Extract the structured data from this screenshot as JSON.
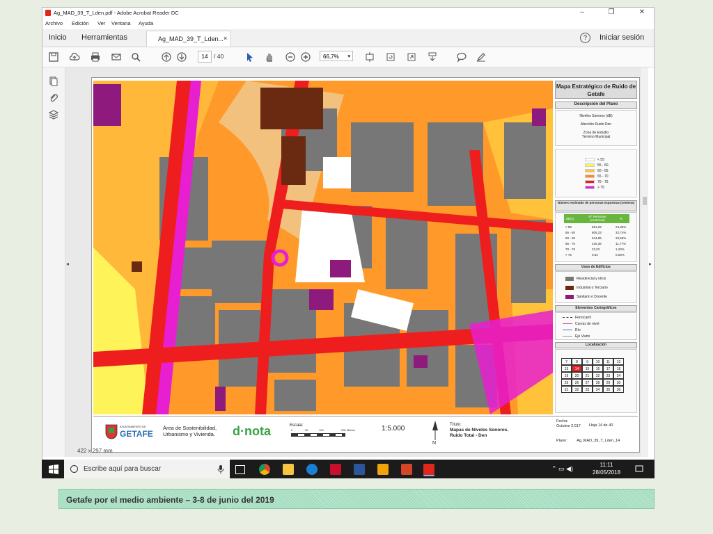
{
  "window": {
    "title": "Ag_MAD_39_T_Lden.pdf - Adobe Acrobat Reader DC",
    "menu": [
      "Archivo",
      "Edición",
      "Ver",
      "Ventana",
      "Ayuda"
    ],
    "minimize": "–",
    "maximize": "❐",
    "close": "✕"
  },
  "tabs": {
    "home": "Inicio",
    "tools": "Herramientas",
    "document": "Ag_MAD_39_T_Lden...",
    "close": "×",
    "help": "?",
    "signin": "Iniciar sesión"
  },
  "toolbar": {
    "page_current": "14",
    "page_of": "/  40",
    "zoom": "66,7%",
    "zoom_chev": "▾"
  },
  "nav": {
    "left_arrow": "◂",
    "right_arrow": "▸"
  },
  "document": {
    "page_size": "422 x 297 mm",
    "legend": {
      "title": "Mapa Estratégico de Ruido de Getafe",
      "desc_header": "Descripción del Plano",
      "desc_lines": [
        "Niveles Sonoros (dB)",
        "Afección Ruido Den",
        "Zona de Estudio",
        "Término Municipal"
      ],
      "levels": [
        {
          "label": "< 55",
          "color": "#ffffff"
        },
        {
          "label": "55 - 60",
          "color": "#fff35a"
        },
        {
          "label": "60 - 65",
          "color": "#ffc23a"
        },
        {
          "label": "65 - 70",
          "color": "#ff8a22"
        },
        {
          "label": "70 - 75",
          "color": "#ee1e1e"
        },
        {
          "label": "> 75",
          "color": "#e81fd0"
        }
      ],
      "people_header": "Número estimado de personas expuestas (centena)",
      "people_cols": [
        "dB(A)",
        "Nº Personas (centenas)",
        "%"
      ],
      "people_rows": [
        [
          "< 55",
          "651,22",
          "24,35%"
        ],
        [
          "55 - 60",
          "805,23",
          "32,74%"
        ],
        [
          "60 - 65",
          "544,85",
          "23,65%"
        ],
        [
          "65 - 70",
          "216,38",
          "11,77%"
        ],
        [
          "70 - 75",
          "23,03",
          "1,23%"
        ],
        [
          "> 75",
          "0,54",
          "0,03%"
        ]
      ],
      "uses_header": "Usos de Edificios",
      "uses": [
        {
          "label": "Residencial y otros",
          "color": "#777777"
        },
        {
          "label": "Industrial o Terciario",
          "color": "#6a2a12"
        },
        {
          "label": "Sanitario o Docente",
          "color": "#8e1a7e"
        }
      ],
      "carto_header": "Elementos Cartográficos",
      "carto": [
        "Ferrocarril",
        "Curvas de nivel",
        "Río",
        "Eje Viario"
      ],
      "loc_header": "Localización",
      "grid": [
        "7",
        "8",
        "9",
        "10",
        "11",
        "12",
        "13",
        "14",
        "15",
        "16",
        "17",
        "18",
        "19",
        "20",
        "21",
        "22",
        "23",
        "24",
        "25",
        "26",
        "27",
        "28",
        "29",
        "30",
        "31",
        "32",
        "33",
        "34",
        "35",
        "36"
      ]
    },
    "footer": {
      "municipality": "GETAFE",
      "municipality_sub": "AYUNTAMIENTO DE",
      "area": "Área de Sostenibilidad, Urbanismo y Vivienda.",
      "brand": "d·nota",
      "escala": "Escala:",
      "scale_ticks": [
        "0",
        "50",
        "100",
        "200 Metros"
      ],
      "ratio": "1:5.000",
      "north": "N",
      "titulo_label": "Título:",
      "titulo": "Mapas de Niveles Sonoros.",
      "titulo2": "Ruido Total - Den",
      "fecha_label": "Fecha:",
      "fecha": "Octubre 2.017",
      "hoja": "Hoja  14  de 40",
      "plano_label": "Plano:",
      "plano": "Ag_MAD_39_T_Lden_14"
    }
  },
  "taskbar": {
    "search_placeholder": "Escribe aquí para buscar",
    "time": "11:11",
    "date": "28/05/2018",
    "apps": [
      "task-view",
      "chrome",
      "file-explorer",
      "edge",
      "acrobat",
      "word",
      "outlook",
      "powerpoint",
      "acrobat-reader"
    ]
  },
  "caption": "Getafe por el medio ambiente – 3-8 de junio del 2019"
}
